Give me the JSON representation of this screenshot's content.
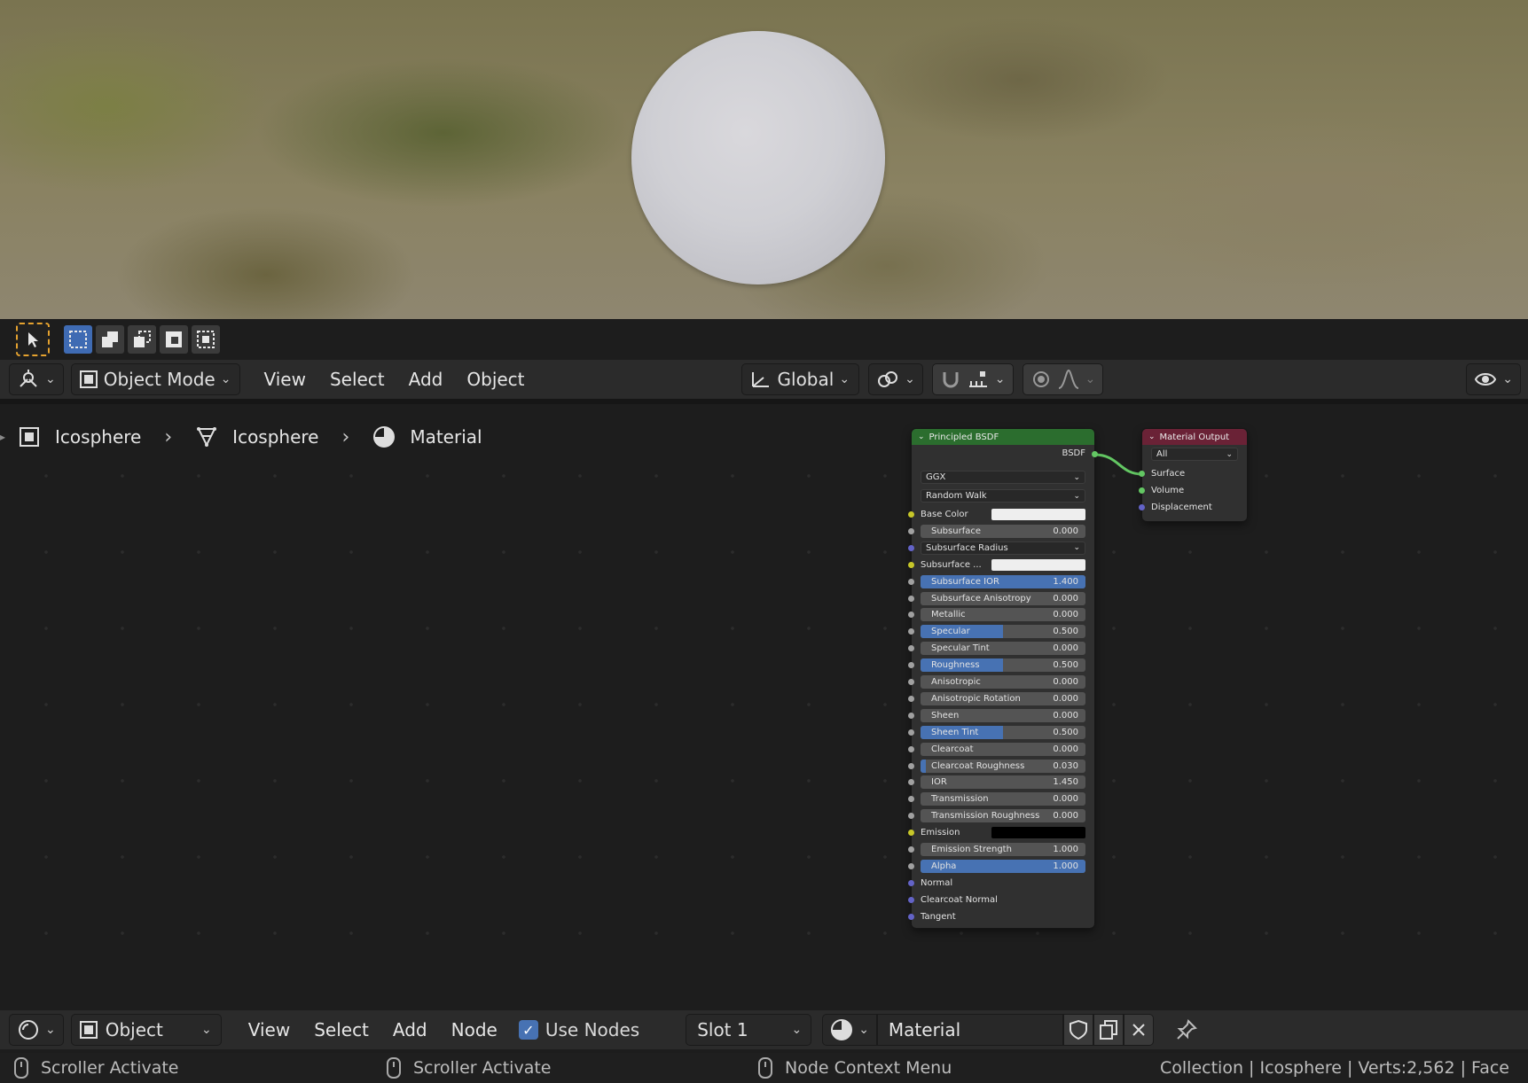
{
  "viewport": {
    "header": {
      "mode_label": "Object Mode",
      "menus": [
        "View",
        "Select",
        "Add",
        "Object"
      ],
      "transform_orientation": "Global"
    }
  },
  "node_editor": {
    "breadcrumb": [
      "Icosphere",
      "Icosphere",
      "Material"
    ],
    "principled": {
      "title": "Principled BSDF",
      "output_label": "BSDF",
      "distribution": "GGX",
      "subsurface_method": "Random Walk",
      "rows": [
        {
          "label": "Base Color",
          "type": "color",
          "color": "#eeeeee",
          "socket": "yellow"
        },
        {
          "label": "Subsurface",
          "type": "value",
          "value": "0.000",
          "fill": 0,
          "socket": "grey"
        },
        {
          "label": "Subsurface Radius",
          "type": "dropdown",
          "socket": "purple"
        },
        {
          "label": "Subsurface ...",
          "type": "color",
          "color": "#eeeeee",
          "socket": "yellow"
        },
        {
          "label": "Subsurface IOR",
          "type": "value",
          "value": "1.400",
          "fill": 1,
          "socket": "grey"
        },
        {
          "label": "Subsurface Anisotropy",
          "type": "value",
          "value": "0.000",
          "fill": 0,
          "socket": "grey"
        },
        {
          "label": "Metallic",
          "type": "value",
          "value": "0.000",
          "fill": 0,
          "socket": "grey"
        },
        {
          "label": "Specular",
          "type": "value",
          "value": "0.500",
          "fill": 0.5,
          "socket": "grey"
        },
        {
          "label": "Specular Tint",
          "type": "value",
          "value": "0.000",
          "fill": 0,
          "socket": "grey"
        },
        {
          "label": "Roughness",
          "type": "value",
          "value": "0.500",
          "fill": 0.5,
          "socket": "grey"
        },
        {
          "label": "Anisotropic",
          "type": "value",
          "value": "0.000",
          "fill": 0,
          "socket": "grey"
        },
        {
          "label": "Anisotropic Rotation",
          "type": "value",
          "value": "0.000",
          "fill": 0,
          "socket": "grey"
        },
        {
          "label": "Sheen",
          "type": "value",
          "value": "0.000",
          "fill": 0,
          "socket": "grey"
        },
        {
          "label": "Sheen Tint",
          "type": "value",
          "value": "0.500",
          "fill": 0.5,
          "socket": "grey"
        },
        {
          "label": "Clearcoat",
          "type": "value",
          "value": "0.000",
          "fill": 0,
          "socket": "grey"
        },
        {
          "label": "Clearcoat Roughness",
          "type": "value",
          "value": "0.030",
          "fill": 0.03,
          "socket": "grey"
        },
        {
          "label": "IOR",
          "type": "value",
          "value": "1.450",
          "fill": 0,
          "socket": "grey"
        },
        {
          "label": "Transmission",
          "type": "value",
          "value": "0.000",
          "fill": 0,
          "socket": "grey"
        },
        {
          "label": "Transmission Roughness",
          "type": "value",
          "value": "0.000",
          "fill": 0,
          "socket": "grey"
        },
        {
          "label": "Emission",
          "type": "color",
          "color": "#000000",
          "socket": "yellow"
        },
        {
          "label": "Emission Strength",
          "type": "value",
          "value": "1.000",
          "fill": 0,
          "socket": "grey"
        },
        {
          "label": "Alpha",
          "type": "value",
          "value": "1.000",
          "fill": 1,
          "socket": "grey"
        },
        {
          "label": "Normal",
          "type": "plain",
          "socket": "purple"
        },
        {
          "label": "Clearcoat Normal",
          "type": "plain",
          "socket": "purple"
        },
        {
          "label": "Tangent",
          "type": "plain",
          "socket": "purple"
        }
      ]
    },
    "output": {
      "title": "Material Output",
      "target": "All",
      "inputs": [
        "Surface",
        "Volume",
        "Displacement"
      ]
    }
  },
  "footer": {
    "type_label": "Object",
    "menus": [
      "View",
      "Select",
      "Add",
      "Node"
    ],
    "use_nodes_label": "Use Nodes",
    "slot_label": "Slot 1",
    "material_name": "Material"
  },
  "status": {
    "left1": "Scroller Activate",
    "left2": "Scroller Activate",
    "mid": "Node Context Menu",
    "right": "Collection | Icosphere | Verts:2,562 | Face"
  },
  "colors": {
    "accent": "#4772b3",
    "bsdf_header": "#2b6d2e",
    "output_header": "#6a2236",
    "socket_green": "#63c763"
  }
}
